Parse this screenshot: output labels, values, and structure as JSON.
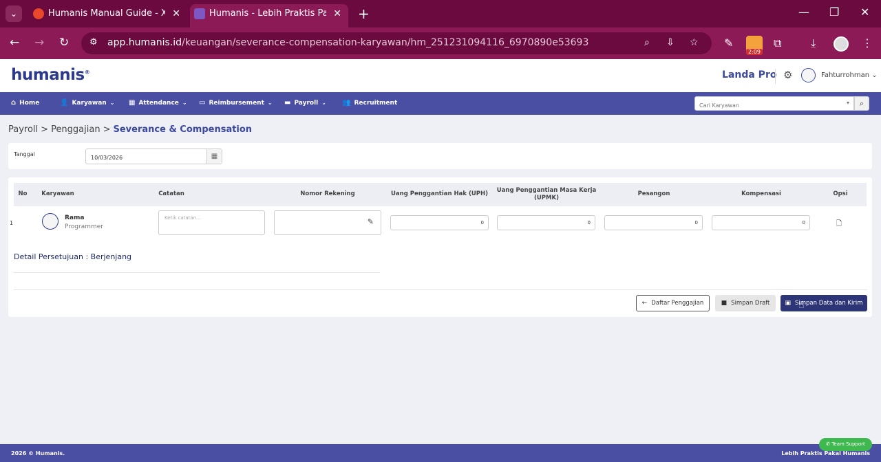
{
  "browser": {
    "tabs": [
      {
        "title": "Humanis Manual Guide - Xmind",
        "close": "✕"
      },
      {
        "title": "Humanis - Lebih Praktis Pakai Humanis",
        "close": "✕"
      }
    ],
    "new_tab": "+",
    "url_host": "app.humanis.id",
    "url_path": "/keuangan/severance-compensation-karyawan/hm_251231094116_6970890e53693",
    "ext_badge": "2:09"
  },
  "app": {
    "logo": "humanis",
    "company": "Landa Pro",
    "user": "Fahturrohman"
  },
  "nav": {
    "items": [
      {
        "label": "Home",
        "icon": "⌂"
      },
      {
        "label": "Karyawan",
        "icon": "👤"
      },
      {
        "label": "Attendance",
        "icon": "▦"
      },
      {
        "label": "Reimbursement",
        "icon": "▭"
      },
      {
        "label": "Payroll",
        "icon": "▬"
      },
      {
        "label": "Recruitment",
        "icon": "👥"
      }
    ],
    "search_placeholder": "Cari Karyawan"
  },
  "breadcrumb": [
    "Payroll",
    "Penggajian",
    "Severance & Compensation"
  ],
  "form": {
    "date_label": "Tanggal",
    "date_value": "10/03/2026"
  },
  "table": {
    "headers": [
      "No",
      "Karyawan",
      "Catatan",
      "Nomor Rekening",
      "Uang Penggantian Hak (UPH)",
      "Uang Penggantian Masa Kerja (UPMK)",
      "Pesangon",
      "Kompensasi",
      "Opsi"
    ],
    "rows": [
      {
        "no": "1",
        "name": "Rama",
        "role": "Programmer",
        "note_placeholder": "Ketik catatan...",
        "uph": "0",
        "upmk": "0",
        "pesangon": "0",
        "kompensasi": "0"
      }
    ]
  },
  "detail_label": "Detail Persetujuan : Berjenjang",
  "buttons": {
    "back": "Daftar Penggajian",
    "draft": "Simpan Draft",
    "save": "Simpan Data dan Kirim"
  },
  "footer": {
    "left": "2026 © Humanis.",
    "right": "Lebih Praktis Pakai Humanis",
    "support": "Team Support"
  }
}
